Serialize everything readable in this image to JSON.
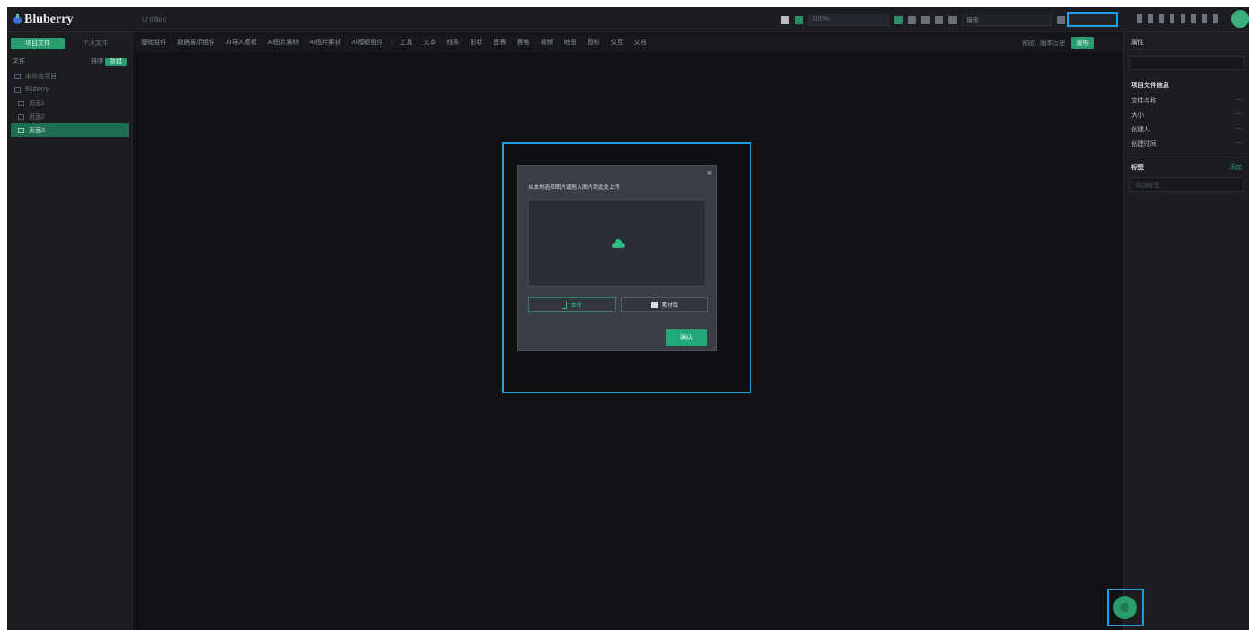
{
  "app": {
    "name": "Bluberry",
    "doc_title": "Untitled"
  },
  "topbar": {
    "zoom_field": "100%",
    "search_placeholder": "搜索",
    "highlight_input": "",
    "icons": [
      "file-icon",
      "play-icon",
      "grid-icon",
      "layout-icon",
      "image-icon",
      "chart-icon",
      "align-icon"
    ]
  },
  "toolbar": {
    "items": [
      "基础组件",
      "数据展示组件",
      "AI导入模板",
      "AI图片素材",
      "AI图片素材",
      "AI模板组件",
      "工具",
      "文本",
      "线条",
      "形状",
      "图表",
      "表格",
      "视频",
      "地图",
      "图标",
      "交互",
      "文档"
    ],
    "right_text": "预览",
    "right_text2": "版本历史",
    "publish_label": "发布"
  },
  "sidebar": {
    "tabs": [
      "项目文件",
      "个人文件"
    ],
    "row_label": "文件",
    "sort_label": "排序",
    "new_label": "新建",
    "tree": [
      {
        "label": "未命名项目",
        "active": false
      },
      {
        "label": "Bluberry",
        "active": false
      },
      {
        "label": "页面1",
        "active": false
      },
      {
        "label": "页面2",
        "active": false
      },
      {
        "label": "页面3",
        "active": true
      }
    ]
  },
  "dialog": {
    "close": "×",
    "title": "从本地选择图片或拖入图片到此处上传",
    "upload_label": "本地",
    "folder_label": "素材库",
    "confirm_label": "确认"
  },
  "rpanel": {
    "tab": "属性",
    "input_placeholder": "",
    "section_title": "项目文件信息",
    "kv": [
      {
        "k": "文件名称",
        "v": "—"
      },
      {
        "k": "大小",
        "v": "—"
      },
      {
        "k": "创建人",
        "v": "—"
      },
      {
        "k": "创建时间",
        "v": "—"
      }
    ],
    "tags_label": "标签",
    "tags_add": "添加",
    "tag_placeholder": "添加标签"
  },
  "colors": {
    "accent": "#2a9d6e",
    "highlight": "#1fa0e0",
    "bg": "#111216"
  }
}
